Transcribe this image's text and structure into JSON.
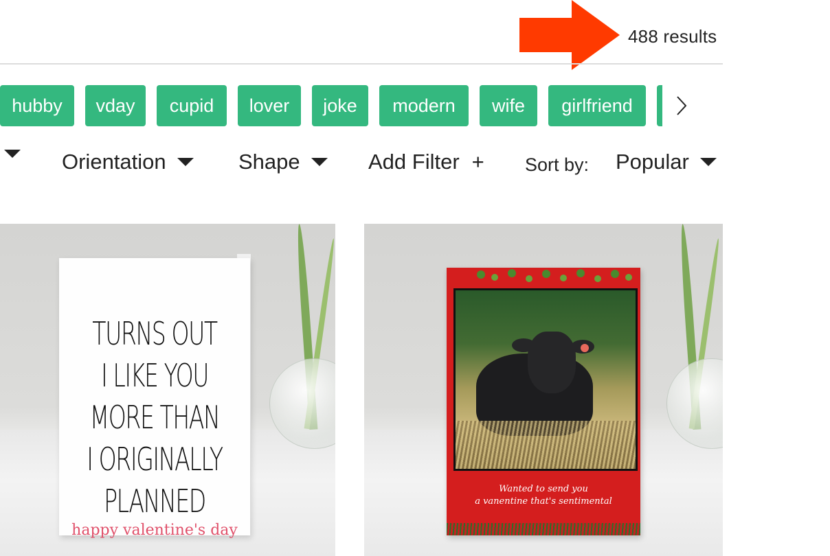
{
  "results": {
    "count_text": "488 results",
    "arrow_color": "#ff3a00"
  },
  "tags": [
    {
      "label": "hubby"
    },
    {
      "label": "vday"
    },
    {
      "label": "cupid"
    },
    {
      "label": "lover"
    },
    {
      "label": "joke"
    },
    {
      "label": "modern"
    },
    {
      "label": "wife"
    },
    {
      "label": "girlfriend"
    }
  ],
  "tag_color": "#34b87f",
  "filters": {
    "orientation": "Orientation",
    "shape": "Shape",
    "add_filter": "Add Filter",
    "add_filter_icon": "+",
    "sort_label": "Sort by:",
    "sort_value": "Popular"
  },
  "cards": [
    {
      "lines": [
        "TURNS OUT",
        "I LIKE YOU",
        "MORE THAN",
        "I ORIGINALLY",
        "PLANNED"
      ],
      "subtitle": "happy valentine's day"
    },
    {
      "line1": "Wanted to send you",
      "line2": "a vanentine that's sentimental",
      "card_color": "#d41e1e"
    }
  ]
}
